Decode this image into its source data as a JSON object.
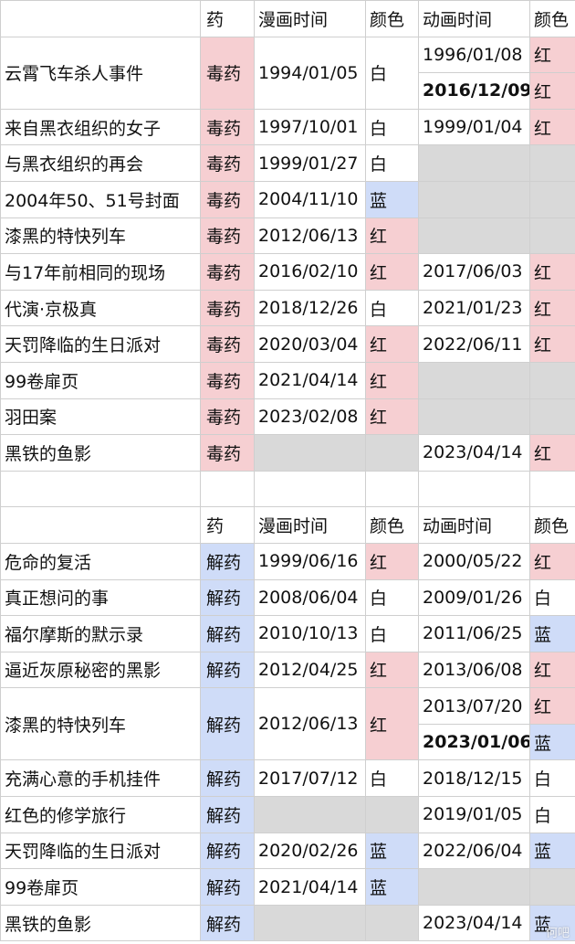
{
  "headers": {
    "drug": "药",
    "manga_date": "漫画时间",
    "color1": "颜色",
    "anime_date": "动画时间",
    "color2": "颜色"
  },
  "poison": [
    {
      "title": "云霄飞车杀人事件",
      "drug": "毒药",
      "manga": "1994/01/05",
      "mcolor": "白",
      "anime": "1996/01/08",
      "acolor": "红",
      "anime2": "2016/12/09",
      "acolor2": "红"
    },
    {
      "title": "来自黑衣组织的女子",
      "drug": "毒药",
      "manga": "1997/10/01",
      "mcolor": "白",
      "anime": "1999/01/04",
      "acolor": "红"
    },
    {
      "title": "与黑衣组织的再会",
      "drug": "毒药",
      "manga": "1999/01/27",
      "mcolor": "白"
    },
    {
      "title": "2004年50、51号封面",
      "drug": "毒药",
      "manga": "2004/11/10",
      "mcolor": "蓝"
    },
    {
      "title": "漆黑的特快列车",
      "drug": "毒药",
      "manga": "2012/06/13",
      "mcolor": "红"
    },
    {
      "title": "与17年前相同的现场",
      "drug": "毒药",
      "manga": "2016/02/10",
      "mcolor": "红",
      "anime": "2017/06/03",
      "acolor": "红"
    },
    {
      "title": "代演·京极真",
      "drug": "毒药",
      "manga": "2018/12/26",
      "mcolor": "白",
      "anime": "2021/01/23",
      "acolor": "红"
    },
    {
      "title": "天罚降临的生日派对",
      "drug": "毒药",
      "manga": "2020/03/04",
      "mcolor": "红",
      "anime": "2022/06/11",
      "acolor": "红"
    },
    {
      "title": "99卷扉页",
      "drug": "毒药",
      "manga": "2021/04/14",
      "mcolor": "红"
    },
    {
      "title": "羽田案",
      "drug": "毒药",
      "manga": "2023/02/08",
      "mcolor": "红"
    },
    {
      "title": "黑铁的鱼影",
      "drug": "毒药",
      "anime": "2023/04/14",
      "acolor": "红"
    }
  ],
  "antidote": [
    {
      "title": "危命的复活",
      "drug": "解药",
      "manga": "1999/06/16",
      "mcolor": "红",
      "anime": "2000/05/22",
      "acolor": "红"
    },
    {
      "title": "真正想问的事",
      "drug": "解药",
      "manga": "2008/06/04",
      "mcolor": "白",
      "anime": "2009/01/26",
      "acolor": "白"
    },
    {
      "title": "福尔摩斯的默示录",
      "drug": "解药",
      "manga": "2010/10/13",
      "mcolor": "白",
      "anime": "2011/06/25",
      "acolor": "蓝"
    },
    {
      "title": "逼近灰原秘密的黑影",
      "drug": "解药",
      "manga": "2012/04/25",
      "mcolor": "红",
      "anime": "2013/06/08",
      "acolor": "红"
    },
    {
      "title": "漆黑的特快列车",
      "drug": "解药",
      "manga": "2012/06/13",
      "mcolor": "红",
      "anime": "2013/07/20",
      "acolor": "红",
      "anime2": "2023/01/06",
      "acolor2": "蓝"
    },
    {
      "title": "充满心意的手机挂件",
      "drug": "解药",
      "manga": "2017/07/12",
      "mcolor": "白",
      "anime": "2018/12/15",
      "acolor": "白"
    },
    {
      "title": "红色的修学旅行",
      "drug": "解药",
      "anime": "2019/01/05",
      "acolor": "白"
    },
    {
      "title": "天罚降临的生日派对",
      "drug": "解药",
      "manga": "2020/02/26",
      "mcolor": "蓝",
      "anime": "2022/06/04",
      "acolor": "蓝"
    },
    {
      "title": "99卷扉页",
      "drug": "解药",
      "manga": "2021/04/14",
      "mcolor": "蓝"
    },
    {
      "title": "黑铁的鱼影",
      "drug": "解药",
      "anime": "2023/04/14",
      "acolor": "蓝"
    }
  ],
  "watermark": "何吧",
  "colors": {
    "pink": "#f6cfd2",
    "blue": "#cfdcf8",
    "grey": "#d9d9d9",
    "border": "#cfcfcf"
  }
}
